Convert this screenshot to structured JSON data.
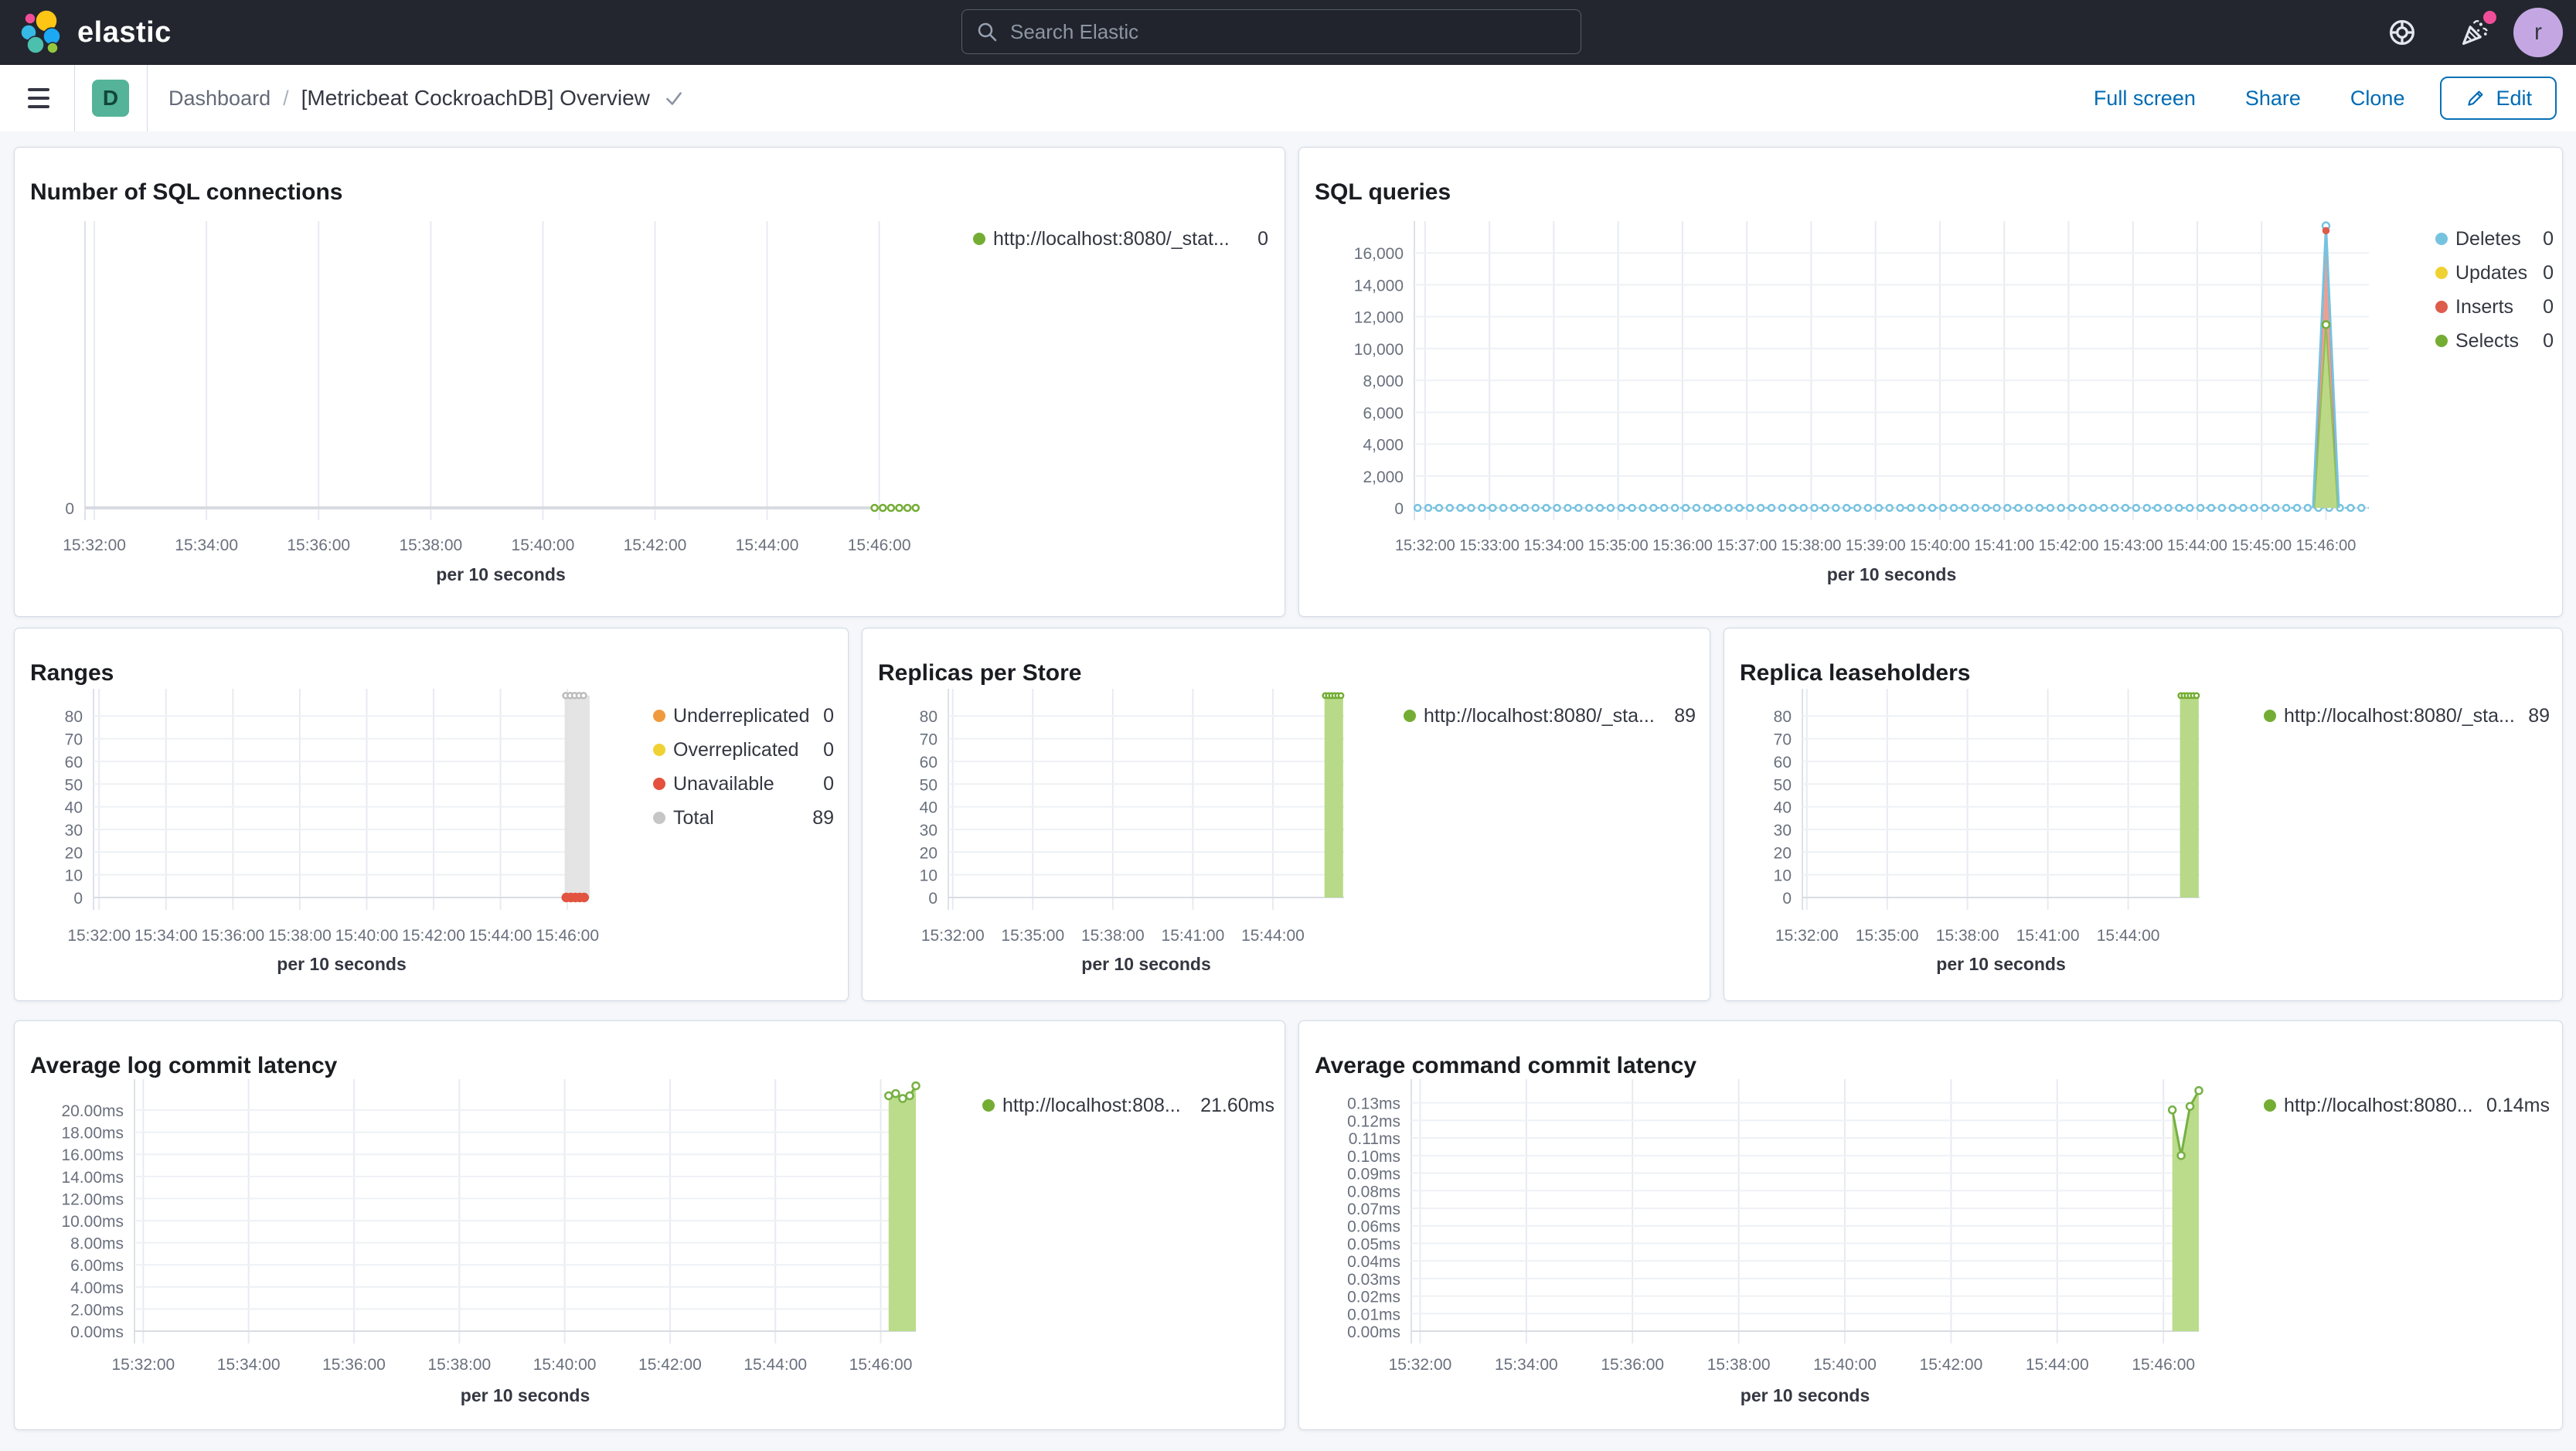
{
  "header": {
    "logo": "elastic",
    "search_placeholder": "Search Elastic",
    "avatar": "r"
  },
  "toolbar": {
    "app_letter": "D",
    "breadcrumb": "Dashboard",
    "separator": "/",
    "title": "[Metricbeat CockroachDB] Overview",
    "full_screen": "Full screen",
    "share": "Share",
    "clone": "Clone",
    "edit": "Edit"
  },
  "colors": {
    "header_bg": "#23262e",
    "page_bg": "#f5f7fa",
    "panel_border": "#d3dae6",
    "accent_blue": "#006bb4",
    "notification_pink": "#f04e98",
    "app_icon_teal": "#54b399",
    "avatar_purple": "#c4a7e2",
    "series_green": "#74ad33",
    "series_blue": "#76c3e0",
    "series_yellow": "#efd134",
    "series_red": "#dd5c4c",
    "series_orange": "#ef9a3d",
    "series_gray": "#c6c6c6"
  },
  "chart_data": [
    {
      "title": "Number of SQL connections",
      "type": "line",
      "xlabel": "per 10 seconds",
      "x_domain": [
        110,
        1000
      ],
      "y_max": 10,
      "x_ticks": [
        {
          "t": 120,
          "label": "15:32:00"
        },
        {
          "t": 240,
          "label": "15:34:00"
        },
        {
          "t": 360,
          "label": "15:36:00"
        },
        {
          "t": 480,
          "label": "15:38:00"
        },
        {
          "t": 600,
          "label": "15:40:00"
        },
        {
          "t": 720,
          "label": "15:42:00"
        },
        {
          "t": 840,
          "label": "15:44:00"
        },
        {
          "t": 960,
          "label": "15:46:00"
        }
      ],
      "y_ticks": [
        {
          "v": 0,
          "label": "0"
        }
      ],
      "elements": [
        {
          "el": "line",
          "color": "#d8dbe1",
          "w": 4,
          "pts": [
            [
              110,
              0
            ],
            [
              1000,
              0
            ]
          ]
        },
        {
          "el": "markerline",
          "y": 0,
          "t0": 955,
          "t1": 999,
          "step": 8.8,
          "color": "#74ad33"
        }
      ],
      "legend": [
        {
          "label": "http://localhost:8080/_stat...",
          "value": "0",
          "color": "#74ad33"
        }
      ]
    },
    {
      "title": "SQL queries",
      "type": "area",
      "xlabel": "per 10 seconds",
      "x_domain": [
        110,
        1000
      ],
      "y_max": 18000,
      "x_ticks": [
        {
          "t": 120,
          "label": "15:32:00"
        },
        {
          "t": 180,
          "label": "15:33:00"
        },
        {
          "t": 240,
          "label": "15:34:00"
        },
        {
          "t": 300,
          "label": "15:35:00"
        },
        {
          "t": 360,
          "label": "15:36:00"
        },
        {
          "t": 420,
          "label": "15:37:00"
        },
        {
          "t": 480,
          "label": "15:38:00"
        },
        {
          "t": 540,
          "label": "15:39:00"
        },
        {
          "t": 600,
          "label": "15:40:00"
        },
        {
          "t": 660,
          "label": "15:41:00"
        },
        {
          "t": 720,
          "label": "15:42:00"
        },
        {
          "t": 780,
          "label": "15:43:00"
        },
        {
          "t": 840,
          "label": "15:44:00"
        },
        {
          "t": 900,
          "label": "15:45:00"
        },
        {
          "t": 960,
          "label": "15:46:00"
        }
      ],
      "y_ticks": [
        {
          "v": 0,
          "label": "0"
        },
        {
          "v": 2000,
          "label": "2,000"
        },
        {
          "v": 4000,
          "label": "4,000"
        },
        {
          "v": 6000,
          "label": "6,000"
        },
        {
          "v": 8000,
          "label": "8,000"
        },
        {
          "v": 10000,
          "label": "10,000"
        },
        {
          "v": 12000,
          "label": "12,000"
        },
        {
          "v": 14000,
          "label": "14,000"
        },
        {
          "v": 16000,
          "label": "16,000"
        }
      ],
      "elements": [
        {
          "el": "markerline",
          "y": 0,
          "t0": 113,
          "t1": 1000,
          "step": 10,
          "color": "#76c3e0"
        },
        {
          "el": "area",
          "pts": [
            [
              949,
              0
            ],
            [
              960,
              17550
            ],
            [
              971,
              0
            ]
          ],
          "fill": "#e9968a",
          "opacity": 0.9,
          "stroke": "#dd5c4c",
          "sw": 2
        },
        {
          "el": "area",
          "pts": [
            [
              949,
              0
            ],
            [
              960,
              11500
            ],
            [
              971,
              0
            ]
          ],
          "fill": "#b8db86",
          "opacity": 0.95,
          "stroke": "#8cc052",
          "sw": 2
        },
        {
          "el": "line",
          "color": "#76c3e0",
          "w": 3,
          "pts": [
            [
              948,
              0
            ],
            [
              960,
              17700
            ],
            [
              972,
              0
            ]
          ]
        },
        {
          "el": "markers",
          "pts": [
            [
              960,
              17700
            ]
          ],
          "stroke": "#76c3e0"
        },
        {
          "el": "markers",
          "pts": [
            [
              960,
              17400
            ]
          ],
          "r": 3.5,
          "fill": "#dd5c4c",
          "stroke": "#dd5c4c"
        },
        {
          "el": "markers",
          "pts": [
            [
              960,
              11500
            ]
          ],
          "stroke": "#74ad33"
        }
      ],
      "legend": [
        {
          "label": "Deletes",
          "value": "0",
          "color": "#76c3e0"
        },
        {
          "label": "Updates",
          "value": "0",
          "color": "#efd134"
        },
        {
          "label": "Inserts",
          "value": "0",
          "color": "#dd5c4c"
        },
        {
          "label": "Selects",
          "value": "0",
          "color": "#74ad33"
        }
      ]
    },
    {
      "title": "Ranges",
      "type": "bar",
      "xlabel": "per 10 seconds",
      "x_domain": [
        110,
        1000
      ],
      "y_max": 92,
      "x_ticks": [
        {
          "t": 120,
          "label": "15:32:00"
        },
        {
          "t": 240,
          "label": "15:34:00"
        },
        {
          "t": 360,
          "label": "15:36:00"
        },
        {
          "t": 480,
          "label": "15:38:00"
        },
        {
          "t": 600,
          "label": "15:40:00"
        },
        {
          "t": 720,
          "label": "15:42:00"
        },
        {
          "t": 840,
          "label": "15:44:00"
        },
        {
          "t": 960,
          "label": "15:46:00"
        }
      ],
      "y_ticks": [
        {
          "v": 0,
          "label": "0"
        },
        {
          "v": 10,
          "label": "10"
        },
        {
          "v": 20,
          "label": "20"
        },
        {
          "v": 30,
          "label": "30"
        },
        {
          "v": 40,
          "label": "40"
        },
        {
          "v": 50,
          "label": "50"
        },
        {
          "v": 60,
          "label": "60"
        },
        {
          "v": 70,
          "label": "70"
        },
        {
          "v": 80,
          "label": "80"
        }
      ],
      "elements": [
        {
          "el": "bar",
          "t0": 955,
          "t1": 1000,
          "v0": 0,
          "v1": 89,
          "fill": "#e2e2e2",
          "opacity": 0.92
        },
        {
          "el": "markers",
          "pts": [
            [
              957,
              89
            ],
            [
              965,
              89
            ],
            [
              973,
              89
            ],
            [
              981,
              89
            ],
            [
              989,
              89
            ]
          ],
          "r": 3.5,
          "stroke": "#bcbcbc"
        },
        {
          "el": "markers",
          "pts": [
            [
              958,
              0
            ],
            [
              966,
              0
            ],
            [
              974,
              0
            ],
            [
              982,
              0
            ],
            [
              990,
              0
            ]
          ],
          "r": 5,
          "fill": "#e25440",
          "stroke": "#e25440"
        }
      ],
      "legend": [
        {
          "label": "Underreplicated",
          "value": "0",
          "color": "#ef9a3d"
        },
        {
          "label": "Overreplicated",
          "value": "0",
          "color": "#efd134"
        },
        {
          "label": "Unavailable",
          "value": "0",
          "color": "#e4503c"
        },
        {
          "label": "Total",
          "value": "89",
          "color": "#c6c6c6"
        }
      ]
    },
    {
      "title": "Replicas per Store",
      "type": "bar",
      "xlabel": "per 10 seconds",
      "x_domain": [
        110,
        1000
      ],
      "y_max": 92,
      "x_ticks": [
        {
          "t": 120,
          "label": "15:32:00"
        },
        {
          "t": 300,
          "label": "15:35:00"
        },
        {
          "t": 480,
          "label": "15:38:00"
        },
        {
          "t": 660,
          "label": "15:41:00"
        },
        {
          "t": 840,
          "label": "15:44:00"
        }
      ],
      "y_ticks": [
        {
          "v": 0,
          "label": "0"
        },
        {
          "v": 10,
          "label": "10"
        },
        {
          "v": 20,
          "label": "20"
        },
        {
          "v": 30,
          "label": "30"
        },
        {
          "v": 40,
          "label": "40"
        },
        {
          "v": 50,
          "label": "50"
        },
        {
          "v": 60,
          "label": "60"
        },
        {
          "v": 70,
          "label": "70"
        },
        {
          "v": 80,
          "label": "80"
        }
      ],
      "elements": [
        {
          "el": "bar",
          "t0": 956,
          "t1": 998,
          "v0": 0,
          "v1": 89,
          "fill": "#b2d77e",
          "opacity": 0.92
        },
        {
          "el": "markers",
          "pts": [
            [
              958,
              89
            ],
            [
              965,
              89
            ],
            [
              972,
              89
            ],
            [
              979,
              89
            ],
            [
              986,
              89
            ],
            [
              993,
              89
            ]
          ],
          "r": 3.2,
          "stroke": "#74ad33"
        }
      ],
      "legend": [
        {
          "label": "http://localhost:8080/_sta...",
          "value": "89",
          "color": "#74ad33"
        }
      ]
    },
    {
      "title": "Replica leaseholders",
      "type": "bar",
      "xlabel": "per 10 seconds",
      "x_domain": [
        110,
        1000
      ],
      "y_max": 92,
      "x_ticks": [
        {
          "t": 120,
          "label": "15:32:00"
        },
        {
          "t": 300,
          "label": "15:35:00"
        },
        {
          "t": 480,
          "label": "15:38:00"
        },
        {
          "t": 660,
          "label": "15:41:00"
        },
        {
          "t": 840,
          "label": "15:44:00"
        }
      ],
      "y_ticks": [
        {
          "v": 0,
          "label": "0"
        },
        {
          "v": 10,
          "label": "10"
        },
        {
          "v": 20,
          "label": "20"
        },
        {
          "v": 30,
          "label": "30"
        },
        {
          "v": 40,
          "label": "40"
        },
        {
          "v": 50,
          "label": "50"
        },
        {
          "v": 60,
          "label": "60"
        },
        {
          "v": 70,
          "label": "70"
        },
        {
          "v": 80,
          "label": "80"
        }
      ],
      "elements": [
        {
          "el": "bar",
          "t0": 956,
          "t1": 998,
          "v0": 0,
          "v1": 89,
          "fill": "#b2d77e",
          "opacity": 0.92
        },
        {
          "el": "markers",
          "pts": [
            [
              958,
              89
            ],
            [
              965,
              89
            ],
            [
              972,
              89
            ],
            [
              979,
              89
            ],
            [
              986,
              89
            ],
            [
              993,
              89
            ]
          ],
          "r": 3.2,
          "stroke": "#74ad33"
        }
      ],
      "legend": [
        {
          "label": "http://localhost:8080/_sta...",
          "value": "89",
          "color": "#74ad33"
        }
      ]
    },
    {
      "title": "Average log commit latency",
      "type": "area",
      "xlabel": "per 10 seconds",
      "x_domain": [
        110,
        1000
      ],
      "y_max": 22.8,
      "x_ticks": [
        {
          "t": 120,
          "label": "15:32:00"
        },
        {
          "t": 240,
          "label": "15:34:00"
        },
        {
          "t": 360,
          "label": "15:36:00"
        },
        {
          "t": 480,
          "label": "15:38:00"
        },
        {
          "t": 600,
          "label": "15:40:00"
        },
        {
          "t": 720,
          "label": "15:42:00"
        },
        {
          "t": 840,
          "label": "15:44:00"
        },
        {
          "t": 960,
          "label": "15:46:00"
        }
      ],
      "y_ticks": [
        {
          "v": 0,
          "label": "0.00ms"
        },
        {
          "v": 2,
          "label": "2.00ms"
        },
        {
          "v": 4,
          "label": "4.00ms"
        },
        {
          "v": 6,
          "label": "6.00ms"
        },
        {
          "v": 8,
          "label": "8.00ms"
        },
        {
          "v": 10,
          "label": "10.00ms"
        },
        {
          "v": 12,
          "label": "12.00ms"
        },
        {
          "v": 14,
          "label": "14.00ms"
        },
        {
          "v": 16,
          "label": "16.00ms"
        },
        {
          "v": 18,
          "label": "18.00ms"
        },
        {
          "v": 20,
          "label": "20.00ms"
        }
      ],
      "elements": [
        {
          "el": "area",
          "pts": [
            [
              969,
              21.3
            ],
            [
              977,
              21.5
            ],
            [
              985,
              21.05
            ],
            [
              993,
              21.3
            ],
            [
              1000,
              22.2
            ]
          ],
          "fill": "#b7da85",
          "opacity": 0.95,
          "stroke": "#76b043",
          "sw": 3
        },
        {
          "el": "markers",
          "pts": [
            [
              969,
              21.3
            ],
            [
              977,
              21.5
            ],
            [
              985,
              21.05
            ],
            [
              993,
              21.3
            ],
            [
              1000,
              22.2
            ]
          ],
          "stroke": "#76b043"
        }
      ],
      "legend": [
        {
          "label": "http://localhost:808...",
          "value": "21.60ms",
          "color": "#74ad33"
        }
      ]
    },
    {
      "title": "Average command commit latency",
      "type": "area",
      "xlabel": "per 10 seconds",
      "x_domain": [
        110,
        1000
      ],
      "y_max": 0.1435,
      "x_ticks": [
        {
          "t": 120,
          "label": "15:32:00"
        },
        {
          "t": 240,
          "label": "15:34:00"
        },
        {
          "t": 360,
          "label": "15:36:00"
        },
        {
          "t": 480,
          "label": "15:38:00"
        },
        {
          "t": 600,
          "label": "15:40:00"
        },
        {
          "t": 720,
          "label": "15:42:00"
        },
        {
          "t": 840,
          "label": "15:44:00"
        },
        {
          "t": 960,
          "label": "15:46:00"
        }
      ],
      "y_ticks": [
        {
          "v": 0,
          "label": "0.00ms"
        },
        {
          "v": 0.01,
          "label": "0.01ms"
        },
        {
          "v": 0.02,
          "label": "0.02ms"
        },
        {
          "v": 0.03,
          "label": "0.03ms"
        },
        {
          "v": 0.04,
          "label": "0.04ms"
        },
        {
          "v": 0.05,
          "label": "0.05ms"
        },
        {
          "v": 0.06,
          "label": "0.06ms"
        },
        {
          "v": 0.07,
          "label": "0.07ms"
        },
        {
          "v": 0.08,
          "label": "0.08ms"
        },
        {
          "v": 0.09,
          "label": "0.09ms"
        },
        {
          "v": 0.1,
          "label": "0.10ms"
        },
        {
          "v": 0.11,
          "label": "0.11ms"
        },
        {
          "v": 0.12,
          "label": "0.12ms"
        },
        {
          "v": 0.13,
          "label": "0.13ms"
        }
      ],
      "elements": [
        {
          "el": "area",
          "pts": [
            [
              970,
              0.126
            ],
            [
              980,
              0.1
            ],
            [
              990,
              0.128
            ],
            [
              1000,
              0.137
            ]
          ],
          "fill": "#b7da85",
          "opacity": 0.95,
          "stroke": "#76b043",
          "sw": 3
        },
        {
          "el": "markers",
          "pts": [
            [
              970,
              0.126
            ],
            [
              980,
              0.1
            ],
            [
              990,
              0.128
            ],
            [
              1000,
              0.137
            ]
          ],
          "stroke": "#76b043"
        }
      ],
      "legend": [
        {
          "label": "http://localhost:8080...",
          "value": "0.14ms",
          "color": "#74ad33"
        }
      ]
    }
  ]
}
